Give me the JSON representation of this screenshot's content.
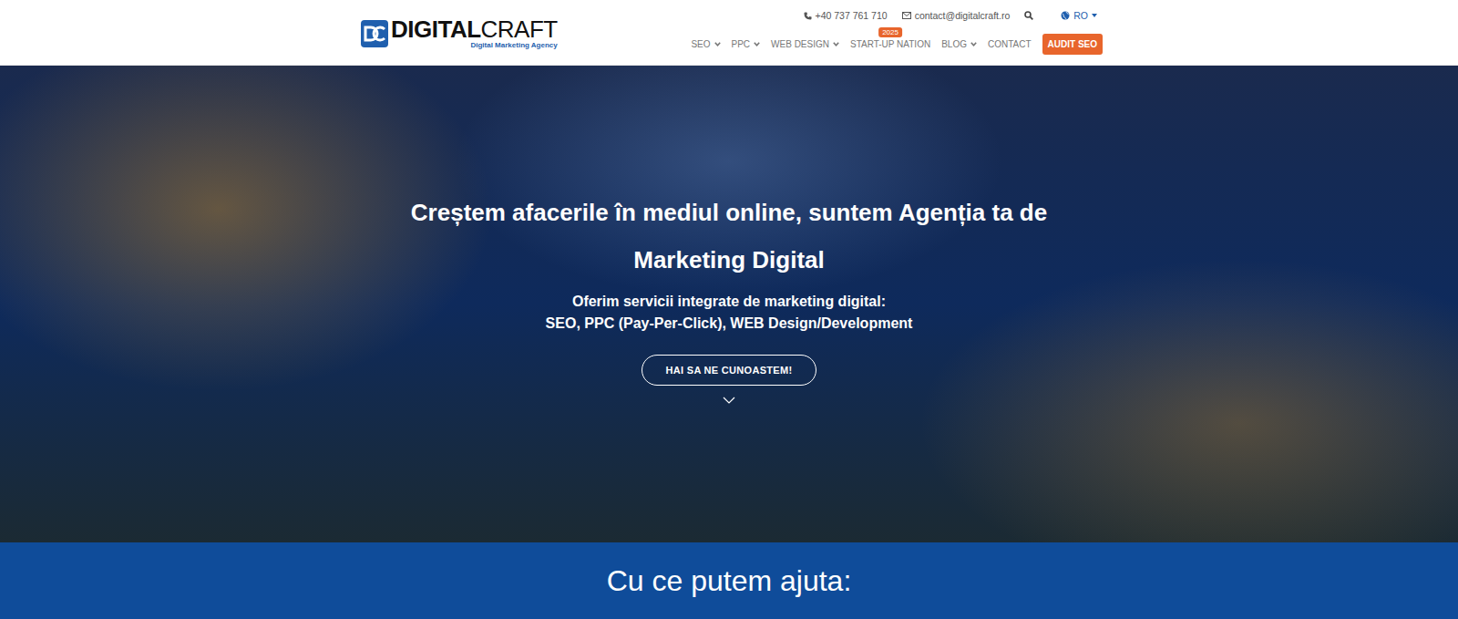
{
  "header": {
    "logo": {
      "bold": "DIGITAL",
      "light": "CRAFT",
      "tagline": "Digital Marketing Agency"
    },
    "contact": {
      "phone": "+40 737 761 710",
      "email": "contact@digitalcraft.ro",
      "language": "RO"
    },
    "nav": [
      {
        "label": "SEO",
        "dropdown": true,
        "badge": null
      },
      {
        "label": "PPC",
        "dropdown": true,
        "badge": null
      },
      {
        "label": "WEB DESIGN",
        "dropdown": true,
        "badge": null
      },
      {
        "label": "START-UP NATION",
        "dropdown": false,
        "badge": "2025"
      },
      {
        "label": "BLOG",
        "dropdown": true,
        "badge": null
      },
      {
        "label": "CONTACT",
        "dropdown": false,
        "badge": null
      }
    ],
    "cta": "AUDIT SEO"
  },
  "hero": {
    "title": "Creștem afacerile în mediul online, suntem Agenția ta de Marketing Digital",
    "subtitle_lines": [
      "Oferim servicii integrate de marketing digital:",
      "SEO, PPC (Pay-Per-Click), WEB Design/Development"
    ],
    "button": "HAI SA NE CUNOASTEM!"
  },
  "section": {
    "title": "Cu ce putem ajuta:"
  }
}
